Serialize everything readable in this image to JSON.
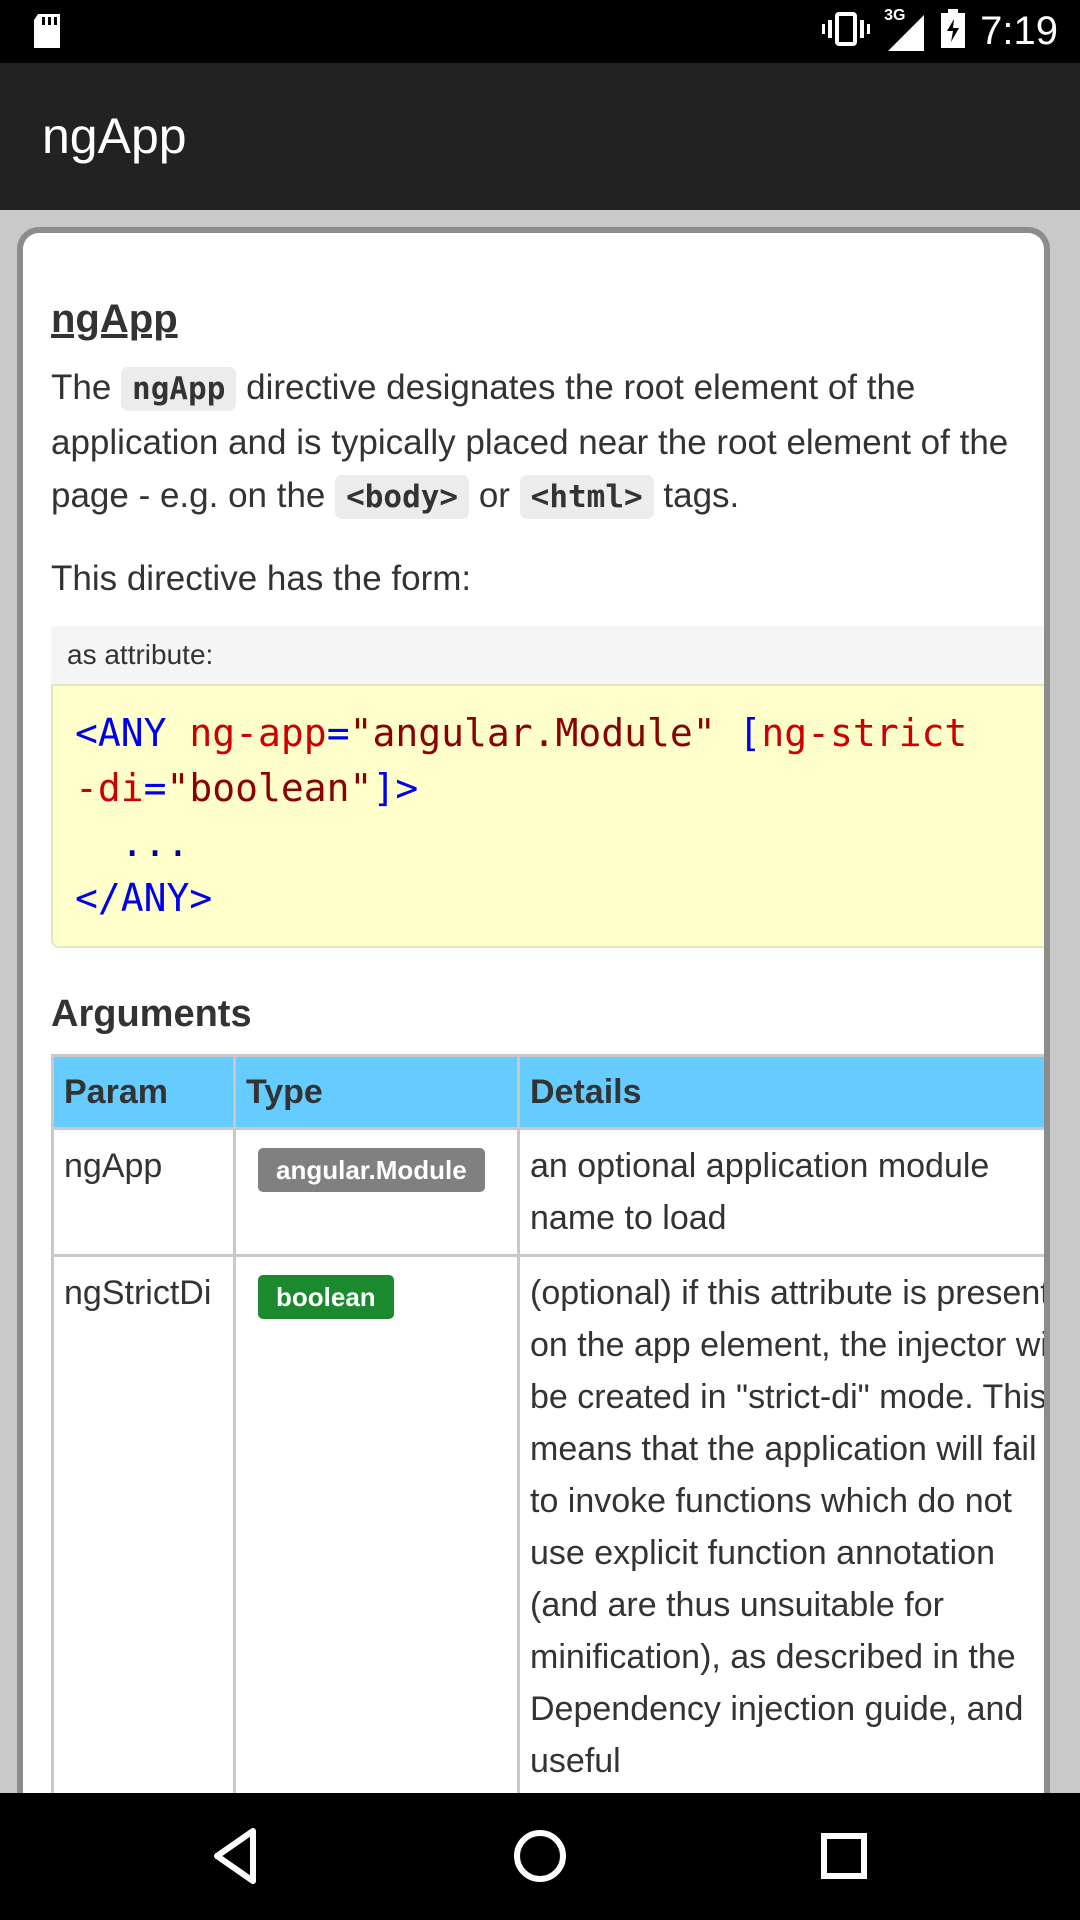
{
  "status_bar": {
    "time": "7:19",
    "network": "3G",
    "icons": [
      "sd-card-icon",
      "vibrate-icon",
      "signal-icon",
      "battery-icon"
    ]
  },
  "app_bar": {
    "title": "ngApp"
  },
  "doc": {
    "heading": "ngApp",
    "intro": {
      "p1": "The ",
      "code1": "ngApp",
      "p2": " directive designates the root element of the application and is typically placed near the root element of the page - e.g. on the ",
      "code2": "<body>",
      "p3": " or ",
      "code3": "<html>",
      "p4": " tags."
    },
    "form_text": "This directive has the form:",
    "usage_label": "as attribute:",
    "code": {
      "open_tag": "<ANY",
      "attr1": "ng-app",
      "eq1": "=",
      "val1": "\"angular.Module\"",
      "bracket_open": "[",
      "attr2_a": "ng-strict",
      "attr2_b": "-di",
      "eq2": "=",
      "val2": "\"boolean\"",
      "bracket_close": "]>",
      "ellipsis": "  ...",
      "close_tag": "</ANY>"
    },
    "arguments_heading": "Arguments",
    "table": {
      "headers": [
        "Param",
        "Type",
        "Details"
      ],
      "rows": [
        {
          "param": "ngApp",
          "type": "angular.Module",
          "details": "an optional application module name to load"
        },
        {
          "param": "ngStrictDi",
          "type": "boolean",
          "details": "(optional) if this attribute is present on the app element, the injector will be created in \"strict-di\" mode. This means that the application will fail to invoke functions which do not use explicit function annotation (and are thus unsuitable for minification), as described in the Dependency injection guide, and useful"
        }
      ]
    }
  },
  "colors": {
    "app_bar_bg": "#222222",
    "table_header_bg": "#66ccff",
    "code_bg": "#ffffcc",
    "badge_module": "#808080",
    "badge_boolean": "#1b8a2f"
  },
  "nav_bar": {
    "icons": [
      "back-icon",
      "home-icon",
      "recents-icon"
    ]
  }
}
